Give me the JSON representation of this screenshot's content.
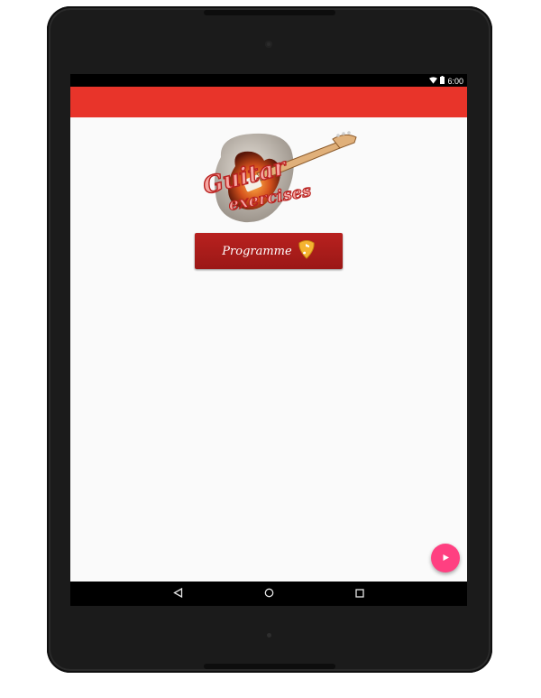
{
  "status_bar": {
    "time": "6:00",
    "icons": [
      "wifi-icon",
      "battery-icon"
    ]
  },
  "app": {
    "logo": {
      "line1": "Guitar",
      "line2": "exercises"
    },
    "program_button_label": "Programme",
    "colors": {
      "app_bar": "#e8342a",
      "button": "#a91c1a",
      "fab": "#ff4081",
      "background": "#fafafa"
    }
  },
  "fab": {
    "icon": "play-icon"
  },
  "nav_bar": {
    "items": [
      "back-icon",
      "home-icon",
      "recents-icon"
    ]
  }
}
